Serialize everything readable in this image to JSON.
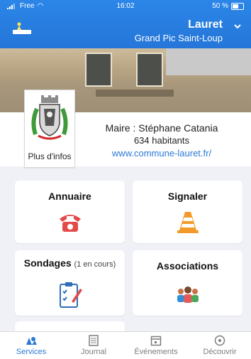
{
  "status_bar": {
    "carrier": "Free",
    "time": "16:02",
    "battery": "50 %"
  },
  "header": {
    "city": "Lauret",
    "region": "Grand Pic Saint-Loup"
  },
  "info": {
    "more_info_label": "Plus d'infos",
    "mayor": "Maire : Stéphane Catania",
    "population": "634 habitants",
    "website": "www.commune-lauret.fr/"
  },
  "tiles": {
    "annuaire": "Annuaire",
    "signaler": "Signaler",
    "sondages": "Sondages",
    "sondages_sub": "(1 en cours)",
    "associations": "Associations"
  },
  "tabs": [
    {
      "label": "Services",
      "active": true
    },
    {
      "label": "Journal",
      "active": false
    },
    {
      "label": "Événements",
      "active": false
    },
    {
      "label": "Découvrir",
      "active": false
    }
  ],
  "colors": {
    "accent": "#2b79d6",
    "header_blue": "#2b86e8"
  }
}
